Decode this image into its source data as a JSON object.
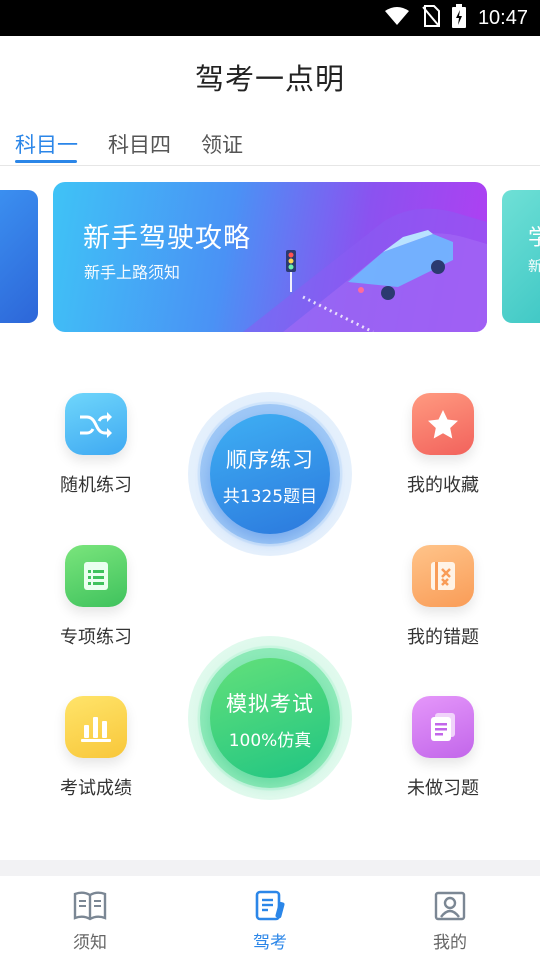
{
  "status_bar": {
    "time": "10:47",
    "icons": [
      "wifi-icon",
      "no-sim-icon",
      "battery-charging-icon"
    ]
  },
  "app": {
    "title": "驾考一点明"
  },
  "tabs": [
    {
      "label": "科目一",
      "active": true
    },
    {
      "label": "科目四",
      "active": false
    },
    {
      "label": "领证",
      "active": false
    }
  ],
  "banner": {
    "title": "新手驾驶攻略",
    "subtitle": "新手上路须知",
    "next_peek_title": "学",
    "next_peek_sub": "新"
  },
  "features": {
    "random": {
      "label": "随机练习",
      "icon": "shuffle-icon",
      "color": "#54c4f5"
    },
    "favorites": {
      "label": "我的收藏",
      "icon": "star-icon",
      "color": "#f77a68"
    },
    "special": {
      "label": "专项练习",
      "icon": "document-list-icon",
      "color": "#5bd36e"
    },
    "mistakes": {
      "label": "我的错题",
      "icon": "error-book-icon",
      "color": "#fbae6b"
    },
    "scores": {
      "label": "考试成绩",
      "icon": "bar-chart-icon",
      "color": "#f9d64f"
    },
    "undone": {
      "label": "未做习题",
      "icon": "pages-icon",
      "color": "#cc7bf0"
    }
  },
  "sequential": {
    "title": "顺序练习",
    "subtitle": "共1325题目"
  },
  "mock_exam": {
    "title": "模拟考试",
    "subtitle": "100%仿真"
  },
  "bottom_nav": [
    {
      "label": "须知",
      "icon": "open-book-icon",
      "active": false
    },
    {
      "label": "驾考",
      "icon": "exam-edit-icon",
      "active": true
    },
    {
      "label": "我的",
      "icon": "user-portrait-icon",
      "active": false
    }
  ]
}
